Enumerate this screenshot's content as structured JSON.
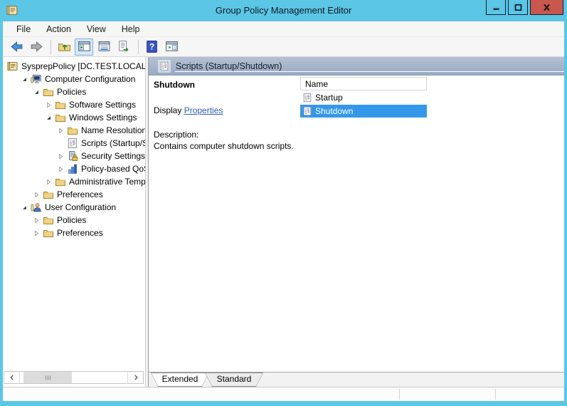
{
  "colors": {
    "titlebar_bg": "#5bc6e6",
    "close_button_bg": "#c9574e",
    "selection_bg": "#3498ea",
    "header_band_top": "#b4c0d4",
    "header_band_bottom": "#9aabc4",
    "link_color": "#2a5db0"
  },
  "titlebar": {
    "title": "Group Policy Management Editor",
    "app_icon": "gpo",
    "controls": [
      "minimize",
      "maximize",
      "close"
    ]
  },
  "menubar": {
    "items": [
      "File",
      "Action",
      "View",
      "Help"
    ]
  },
  "toolbar": {
    "buttons": [
      "back",
      "forward",
      "|",
      "up-one-level",
      "show-console-tree",
      "properties",
      "export-list",
      "|",
      "help",
      "show-action-pane"
    ],
    "active": "show-console-tree"
  },
  "tree": {
    "items": [
      {
        "label": "SysprepPolicy [DC.TEST.LOCAL]",
        "icon": "gpo",
        "level": 0,
        "expander": "none"
      },
      {
        "label": "Computer Configuration",
        "icon": "computer",
        "level": 1,
        "expander": "expanded"
      },
      {
        "label": "Policies",
        "icon": "folder",
        "level": 2,
        "expander": "expanded"
      },
      {
        "label": "Software Settings",
        "icon": "folder",
        "level": 3,
        "expander": "collapsed"
      },
      {
        "label": "Windows Settings",
        "icon": "folder",
        "level": 3,
        "expander": "expanded"
      },
      {
        "label": "Name Resolution Policy",
        "icon": "folder",
        "level": 4,
        "expander": "collapsed"
      },
      {
        "label": "Scripts (Startup/Shutdown)",
        "icon": "scripts",
        "level": 4,
        "expander": "none"
      },
      {
        "label": "Security Settings",
        "icon": "security",
        "level": 4,
        "expander": "collapsed"
      },
      {
        "label": "Policy-based QoS",
        "icon": "qos",
        "level": 4,
        "expander": "collapsed"
      },
      {
        "label": "Administrative Templates",
        "icon": "folder",
        "level": 3,
        "expander": "collapsed"
      },
      {
        "label": "Preferences",
        "icon": "folder",
        "level": 2,
        "expander": "collapsed"
      },
      {
        "label": "User Configuration",
        "icon": "user",
        "level": 1,
        "expander": "expanded"
      },
      {
        "label": "Policies",
        "icon": "folder",
        "level": 2,
        "expander": "collapsed"
      },
      {
        "label": "Preferences",
        "icon": "folder",
        "level": 2,
        "expander": "collapsed"
      }
    ]
  },
  "content_header": {
    "icon": "scripts",
    "title": "Scripts (Startup/Shutdown)"
  },
  "extended": {
    "item_name": "Shutdown",
    "display_label": "Display",
    "properties_link": "Properties",
    "description_label": "Description:",
    "description_text": "Contains computer shutdown scripts."
  },
  "list": {
    "column": "Name",
    "items": [
      {
        "name": "Startup",
        "icon": "scripts",
        "selected": false
      },
      {
        "name": "Shutdown",
        "icon": "scripts",
        "selected": true
      }
    ]
  },
  "tabs": {
    "items": [
      {
        "label": "Extended",
        "active": true
      },
      {
        "label": "Standard",
        "active": false
      }
    ]
  }
}
